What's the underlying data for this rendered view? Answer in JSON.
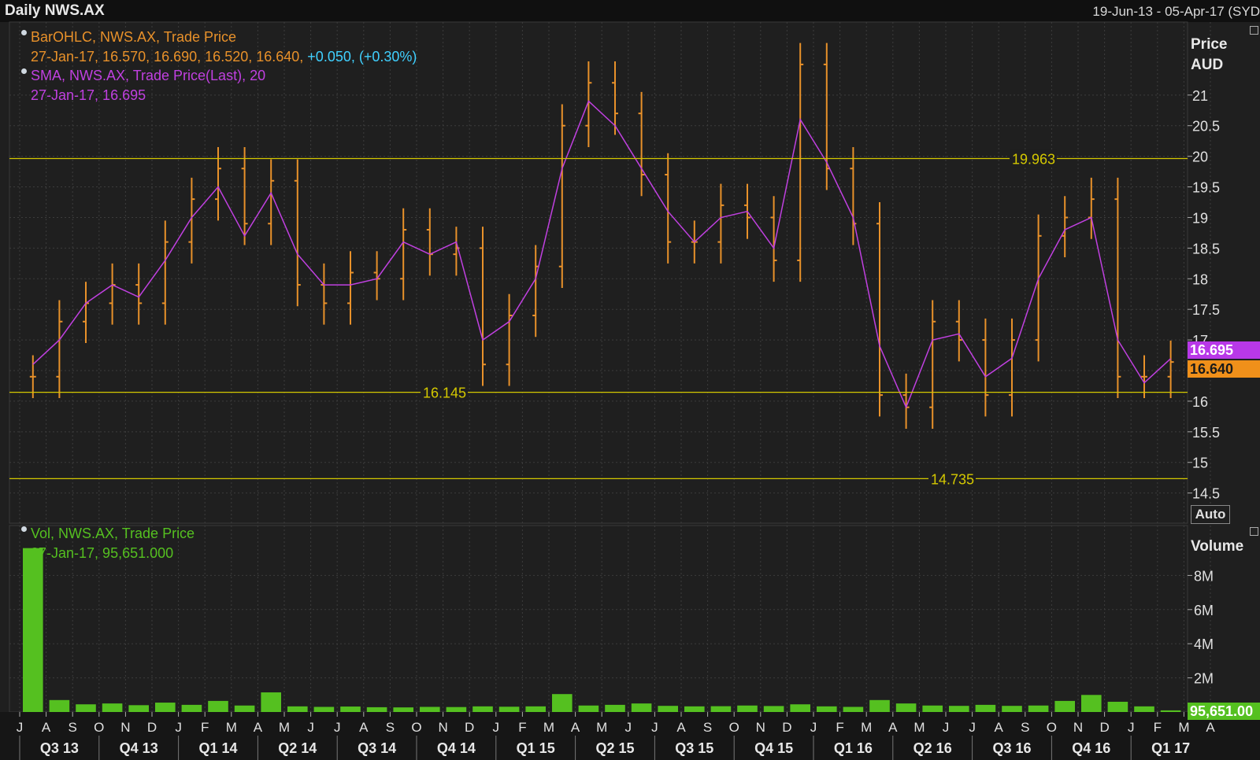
{
  "header": {
    "title": "Daily NWS.AX",
    "date_range": "19-Jun-13 - 05-Apr-17 (SYD"
  },
  "legend": {
    "ohlc_name": "BarOHLC, NWS.AX, Trade Price",
    "ohlc_values": "27-Jan-17, 16.570, 16.690, 16.520, 16.640,",
    "ohlc_change": "+0.050, (+0.30%)",
    "sma_name": "SMA, NWS.AX, Trade Price(Last),  20",
    "sma_value": "27-Jan-17, 16.695",
    "vol_name": "Vol, NWS.AX, Trade Price",
    "vol_value": "27-Jan-17, 95,651.000"
  },
  "price_axis": {
    "title_line1": "Price",
    "title_line2": "AUD",
    "auto_label": "Auto",
    "sma_tag": "16.695",
    "last_tag": "16.640"
  },
  "volume_axis": {
    "title": "Volume",
    "last_tag": "95,651.00"
  },
  "colors": {
    "background": "#1f1f1f",
    "bars": "#e8912a",
    "sma": "#c040e0",
    "volume": "#55c020",
    "hlines": "#d4c800",
    "grid": "#3c3c3c",
    "change": "#40d0ff"
  },
  "chart_data": [
    {
      "type": "line",
      "title": "Daily NWS.AX",
      "ylabel": "Price AUD",
      "ylim": [
        14.2,
        22.0
      ],
      "yticks": [
        "14.5",
        "15",
        "15.5",
        "16",
        "16.5",
        "17",
        "17.5",
        "18",
        "18.5",
        "19",
        "19.5",
        "20",
        "20.5",
        "21"
      ],
      "x_range": [
        "19-Jun-13",
        "05-Apr-17"
      ],
      "series": [
        {
          "name": "BarOHLC, NWS.AX, Trade Price",
          "style": "ohlc bars (approx. close by month)",
          "x": [
            "Jun-13",
            "Jul-13",
            "Aug-13",
            "Sep-13",
            "Oct-13",
            "Nov-13",
            "Dec-13",
            "Jan-14",
            "Feb-14",
            "Mar-14",
            "Apr-14",
            "May-14",
            "Jun-14",
            "Jul-14",
            "Aug-14",
            "Sep-14",
            "Oct-14",
            "Nov-14",
            "Dec-14",
            "Jan-15",
            "Feb-15",
            "Mar-15",
            "Apr-15",
            "May-15",
            "Jun-15",
            "Jul-15",
            "Aug-15",
            "Sep-15",
            "Oct-15",
            "Nov-15",
            "Dec-15",
            "Jan-16",
            "Feb-16",
            "Mar-16",
            "Apr-16",
            "May-16",
            "Jun-16",
            "Jul-16",
            "Aug-16",
            "Sep-16",
            "Oct-16",
            "Nov-16",
            "Dec-16",
            "Jan-17"
          ],
          "values": [
            16.4,
            17.3,
            17.6,
            17.9,
            17.6,
            18.6,
            19.3,
            19.8,
            18.9,
            19.6,
            17.9,
            17.6,
            18.1,
            18.0,
            18.8,
            18.4,
            18.5,
            16.6,
            17.4,
            18.2,
            20.5,
            21.2,
            20.7,
            19.7,
            18.6,
            18.6,
            19.2,
            19.0,
            18.3,
            21.5,
            19.8,
            18.9,
            16.1,
            15.9,
            17.3,
            17.0,
            16.1,
            17.0,
            18.7,
            19.0,
            19.3,
            16.4,
            16.4,
            16.64
          ]
        },
        {
          "name": "SMA, NWS.AX, Trade Price(Last),  20",
          "style": "line",
          "x": [
            "Jun-13",
            "Jul-13",
            "Aug-13",
            "Sep-13",
            "Oct-13",
            "Nov-13",
            "Dec-13",
            "Jan-14",
            "Feb-14",
            "Mar-14",
            "Apr-14",
            "May-14",
            "Jun-14",
            "Jul-14",
            "Aug-14",
            "Sep-14",
            "Oct-14",
            "Nov-14",
            "Dec-14",
            "Jan-15",
            "Feb-15",
            "Mar-15",
            "Apr-15",
            "May-15",
            "Jun-15",
            "Jul-15",
            "Aug-15",
            "Sep-15",
            "Oct-15",
            "Nov-15",
            "Dec-15",
            "Jan-16",
            "Feb-16",
            "Mar-16",
            "Apr-16",
            "May-16",
            "Jun-16",
            "Jul-16",
            "Aug-16",
            "Sep-16",
            "Oct-16",
            "Nov-16",
            "Dec-16",
            "Jan-17"
          ],
          "values": [
            16.6,
            17.0,
            17.6,
            17.9,
            17.7,
            18.3,
            19.0,
            19.5,
            18.7,
            19.4,
            18.4,
            17.9,
            17.9,
            18.0,
            18.6,
            18.4,
            18.6,
            17.0,
            17.3,
            18.0,
            19.8,
            20.9,
            20.5,
            19.8,
            19.1,
            18.6,
            19.0,
            19.1,
            18.5,
            20.6,
            19.9,
            19.0,
            16.9,
            15.9,
            17.0,
            17.1,
            16.4,
            16.7,
            18.0,
            18.8,
            19.0,
            17.0,
            16.3,
            16.695
          ]
        }
      ],
      "reference_lines": [
        {
          "label": "19.963",
          "value": 19.963
        },
        {
          "label": "16.145",
          "value": 16.145
        },
        {
          "label": "14.735",
          "value": 14.735
        }
      ]
    },
    {
      "type": "bar",
      "title": "Vol, NWS.AX, Trade Price",
      "ylabel": "Volume",
      "ylim": [
        0,
        10000000
      ],
      "yticks": [
        "2M",
        "4M",
        "6M",
        "8M"
      ],
      "x": [
        "Jun-13",
        "Jul-13",
        "Aug-13",
        "Sep-13",
        "Oct-13",
        "Nov-13",
        "Dec-13",
        "Jan-14",
        "Feb-14",
        "Mar-14",
        "Apr-14",
        "May-14",
        "Jun-14",
        "Jul-14",
        "Aug-14",
        "Sep-14",
        "Oct-14",
        "Nov-14",
        "Dec-14",
        "Jan-15",
        "Feb-15",
        "Mar-15",
        "Apr-15",
        "May-15",
        "Jun-15",
        "Jul-15",
        "Aug-15",
        "Sep-15",
        "Oct-15",
        "Nov-15",
        "Dec-15",
        "Jan-16",
        "Feb-16",
        "Mar-16",
        "Apr-16",
        "May-16",
        "Jun-16",
        "Jul-16",
        "Aug-16",
        "Sep-16",
        "Oct-16",
        "Nov-16",
        "Dec-16",
        "Jan-17"
      ],
      "values": [
        9600000,
        700000,
        450000,
        500000,
        400000,
        550000,
        420000,
        650000,
        380000,
        1150000,
        330000,
        300000,
        320000,
        280000,
        270000,
        300000,
        290000,
        330000,
        310000,
        330000,
        1050000,
        380000,
        420000,
        500000,
        360000,
        330000,
        340000,
        380000,
        350000,
        450000,
        330000,
        300000,
        700000,
        500000,
        380000,
        360000,
        420000,
        360000,
        380000,
        650000,
        1000000,
        600000,
        330000,
        95651
      ]
    }
  ],
  "x_axis": {
    "months": [
      "J",
      "A",
      "S",
      "O",
      "N",
      "D",
      "J",
      "F",
      "M",
      "A",
      "M",
      "J",
      "J",
      "A",
      "S",
      "O",
      "N",
      "D",
      "J",
      "F",
      "M",
      "A",
      "M",
      "J",
      "J",
      "A",
      "S",
      "O",
      "N",
      "D",
      "J",
      "F",
      "M",
      "A",
      "M",
      "J",
      "J",
      "A",
      "S",
      "O",
      "N",
      "D",
      "J",
      "F",
      "M",
      "A"
    ],
    "quarters": [
      "Q3 13",
      "Q4 13",
      "Q1 14",
      "Q2 14",
      "Q3 14",
      "Q4 14",
      "Q1 15",
      "Q2 15",
      "Q3 15",
      "Q4 15",
      "Q1 16",
      "Q2 16",
      "Q3 16",
      "Q4 16",
      "Q1 17"
    ]
  }
}
